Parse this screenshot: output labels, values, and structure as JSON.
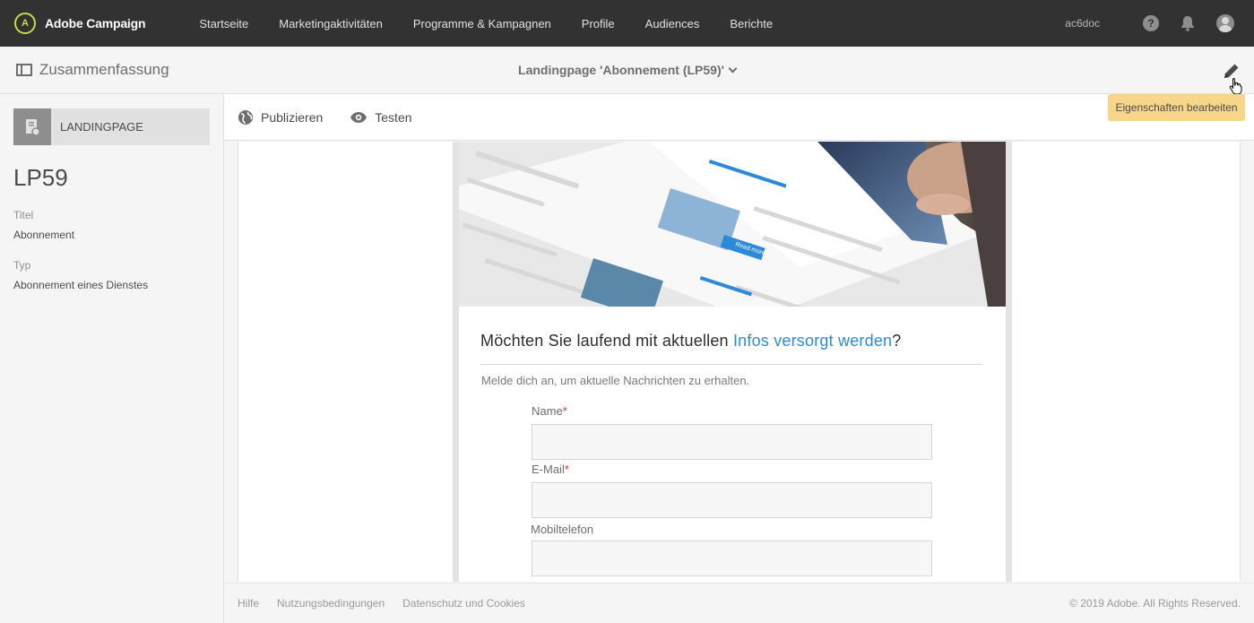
{
  "app": {
    "title": "Adobe Campaign",
    "logo_glyph": "A"
  },
  "nav": {
    "items": [
      {
        "label": "Startseite"
      },
      {
        "label": "Marketingaktivitäten"
      },
      {
        "label": "Programme & Kampagnen"
      },
      {
        "label": "Profile"
      },
      {
        "label": "Audiences"
      },
      {
        "label": "Berichte"
      }
    ],
    "user_code": "ac6doc",
    "help_glyph": "?"
  },
  "header": {
    "summary_label": "Zusammenfassung",
    "page_title": "Landingpage 'Abonnement (LP59)'",
    "edit_tooltip": "Eigenschaften bearbeiten"
  },
  "sidebar": {
    "type_label": "LANDINGPAGE",
    "id": "LP59",
    "title_label": "Titel",
    "title_value": "Abonnement",
    "type_field_label": "Typ",
    "type_field_value": "Abonnement eines Dienstes"
  },
  "actions": {
    "publish_label": "Publizieren",
    "test_label": "Testen"
  },
  "landing_page": {
    "heading_prefix": "Möchten Sie laufend mit aktuellen ",
    "heading_highlight": "Infos versorgt werden",
    "heading_suffix": "?",
    "intro": "Melde dich an, um aktuelle Nachrichten zu erhalten.",
    "fields": [
      {
        "label": "Name",
        "required_mark": "*",
        "value": ""
      },
      {
        "label": "E-Mail",
        "required_mark": "*",
        "value": ""
      },
      {
        "label": "Mobiltelefon",
        "required_mark": "",
        "value": ""
      }
    ],
    "hero_texts": {
      "button": "Read more"
    }
  },
  "footer": {
    "links": [
      "Hilfe",
      "Nutzungsbedingungen",
      "Datenschutz und Cookies"
    ],
    "copyright": "© 2019 Adobe. All Rights Reserved."
  },
  "colors": {
    "topbar": "#323232",
    "accent_blue": "#2d8ad8",
    "tooltip": "#f7d68a",
    "required": "#e53030"
  }
}
